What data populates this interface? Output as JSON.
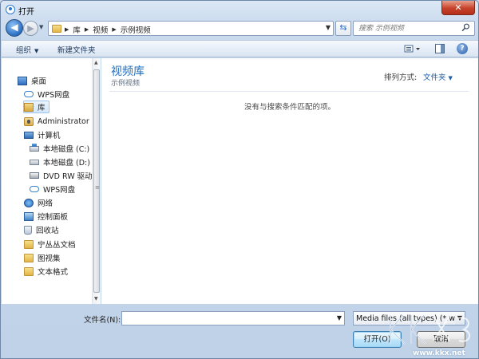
{
  "window": {
    "title": "打开",
    "close_label": "✕"
  },
  "address": {
    "crumbs": [
      "库",
      "视频",
      "示例视频"
    ],
    "search_placeholder": "搜索 示例视频"
  },
  "toolbar": {
    "organize_label": "组织",
    "new_folder_label": "新建文件夹"
  },
  "sidebar": {
    "items": [
      {
        "label": "桌面",
        "icon": "desktop-icon"
      },
      {
        "label": "WPS网盘",
        "icon": "cloud-icon"
      },
      {
        "label": "库",
        "icon": "library-icon",
        "selected": true
      },
      {
        "label": "Administrator",
        "icon": "user-folder-icon"
      },
      {
        "label": "计算机",
        "icon": "computer-icon"
      },
      {
        "label": "本地磁盘 (C:)",
        "icon": "system-disk-icon"
      },
      {
        "label": "本地磁盘 (D:)",
        "icon": "disk-icon"
      },
      {
        "label": "DVD RW 驱动",
        "icon": "dvd-drive-icon"
      },
      {
        "label": "WPS网盘",
        "icon": "cloud-icon"
      },
      {
        "label": "网络",
        "icon": "network-icon"
      },
      {
        "label": "控制面板",
        "icon": "control-panel-icon"
      },
      {
        "label": "回收站",
        "icon": "recycle-bin-icon"
      },
      {
        "label": "宁丛丛文档",
        "icon": "folder-icon"
      },
      {
        "label": "图视集",
        "icon": "folder-icon"
      },
      {
        "label": "文本格式",
        "icon": "folder-icon"
      }
    ]
  },
  "main": {
    "library_title": "视频库",
    "library_subtitle": "示例视频",
    "arrange_label": "排列方式:",
    "arrange_value": "文件夹",
    "empty_message": "没有与搜索条件匹配的项。"
  },
  "bottom": {
    "filename_label": "文件名(N):",
    "filename_value": "",
    "filetype_value": "Media files (all types) (*.wmv",
    "open_label": "打开(O)",
    "cancel_label": "取消"
  },
  "watermark": {
    "url": "www.kkx.net"
  },
  "colors": {
    "accent": "#1e6fbf",
    "window_bg": "#c6d8ec",
    "close": "#c7422a"
  }
}
